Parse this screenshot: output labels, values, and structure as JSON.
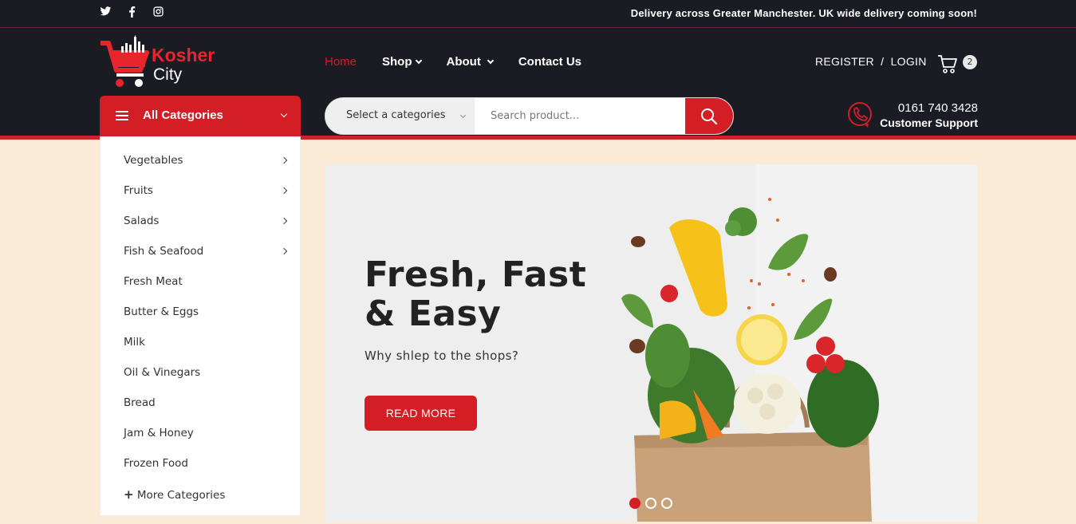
{
  "topbar": {
    "social": [
      "twitter-icon",
      "facebook-icon",
      "instagram-icon"
    ],
    "delivery_text": "Delivery across Greater Manchester. UK wide delivery coming soon!"
  },
  "logo": {
    "line1": "Kosher",
    "line2": "City"
  },
  "nav": {
    "items": [
      {
        "label": "Home",
        "active": true,
        "dropdown": false
      },
      {
        "label": "Shop",
        "active": false,
        "dropdown": true
      },
      {
        "label": "About",
        "active": false,
        "dropdown": true
      },
      {
        "label": "Contact Us",
        "active": false,
        "dropdown": false
      }
    ]
  },
  "account": {
    "register": "REGISTER",
    "separator": "/",
    "login": "LOGIN"
  },
  "cart": {
    "count": "2"
  },
  "categories_button": {
    "label": "All Categories"
  },
  "search": {
    "category_select": "Select a categories",
    "placeholder": "Search product..."
  },
  "support": {
    "phone": "0161 740 3428",
    "label": "Customer Support"
  },
  "categories": [
    {
      "label": "Vegetables",
      "has_children": true
    },
    {
      "label": "Fruits",
      "has_children": true
    },
    {
      "label": "Salads",
      "has_children": true
    },
    {
      "label": "Fish & Seafood",
      "has_children": true
    },
    {
      "label": "Fresh Meat",
      "has_children": false
    },
    {
      "label": "Butter & Eggs",
      "has_children": false
    },
    {
      "label": "Milk",
      "has_children": false
    },
    {
      "label": "Oil & Vinegars",
      "has_children": false
    },
    {
      "label": "Bread",
      "has_children": false
    },
    {
      "label": "Jam & Honey",
      "has_children": false
    },
    {
      "label": "Frozen Food",
      "has_children": false
    }
  ],
  "more_categories": "More Categories",
  "hero": {
    "title_line1": "Fresh, Fast",
    "title_line2": "& Easy",
    "subtitle": "Why shlep to the shops?",
    "button": "READ MORE",
    "slides": 3,
    "active_slide": 1
  },
  "colors": {
    "accent": "#d21e24",
    "header_bg": "#1b1b24",
    "page_bg": "#faebd7"
  }
}
